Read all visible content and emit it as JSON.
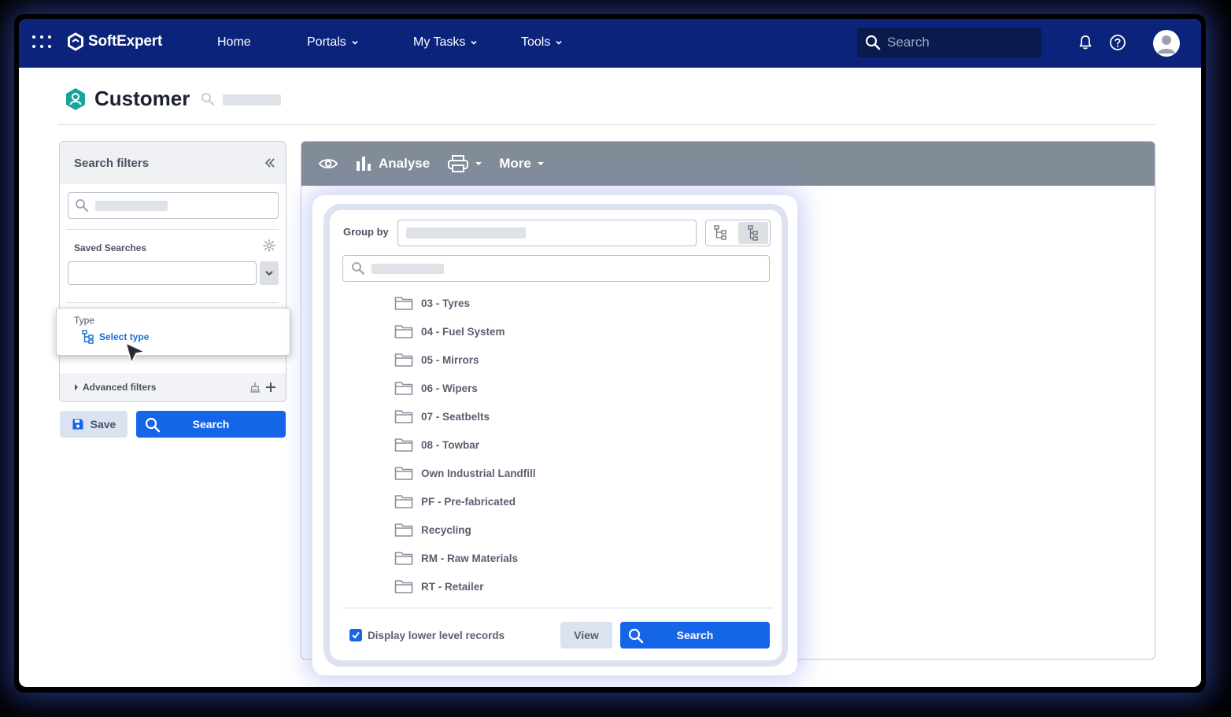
{
  "app": {
    "brand": "SoftExpert"
  },
  "nav": {
    "items": [
      {
        "label": "Home",
        "dropdown": false
      },
      {
        "label": "Portals",
        "dropdown": true
      },
      {
        "label": "My Tasks",
        "dropdown": true
      },
      {
        "label": "Tools",
        "dropdown": true
      }
    ],
    "search_placeholder": "Search"
  },
  "page": {
    "title": "Customer"
  },
  "filters": {
    "title": "Search filters",
    "saved_searches_label": "Saved Searches",
    "type_label": "Type",
    "select_type_label": "Select type",
    "advanced_filters_label": "Advanced filters",
    "save_label": "Save",
    "search_label": "Search"
  },
  "toolbar": {
    "analyse_label": "Analyse",
    "more_label": "More"
  },
  "group_popup": {
    "group_by_label": "Group by",
    "items": [
      "03 - Tyres",
      "04 - Fuel System",
      "05 - Mirrors",
      "06 - Wipers",
      "07 - Seatbelts",
      "08 - Towbar",
      "Own Industrial Landfill",
      "PF - Pre-fabricated",
      "Recycling",
      "RM - Raw Materials",
      "RT - Retailer"
    ],
    "display_lower_label": "Display lower level records",
    "display_lower_checked": true,
    "view_label": "View",
    "search_label": "Search"
  },
  "colors": {
    "topbar": "#0b237a",
    "primary_button": "#1565e8",
    "toolbar": "#828c99",
    "link": "#1a6fd1"
  },
  "icons": [
    "apps-grid-icon",
    "softexpert-logo-icon",
    "search-icon",
    "bell-icon",
    "help-icon",
    "user-avatar-icon",
    "customer-icon",
    "collapse-icon",
    "gear-icon",
    "chevron-down-icon",
    "tree-icon",
    "broom-icon",
    "plus-icon",
    "save-icon",
    "eye-icon",
    "bar-chart-icon",
    "printer-icon",
    "folder-icon",
    "check-icon"
  ]
}
